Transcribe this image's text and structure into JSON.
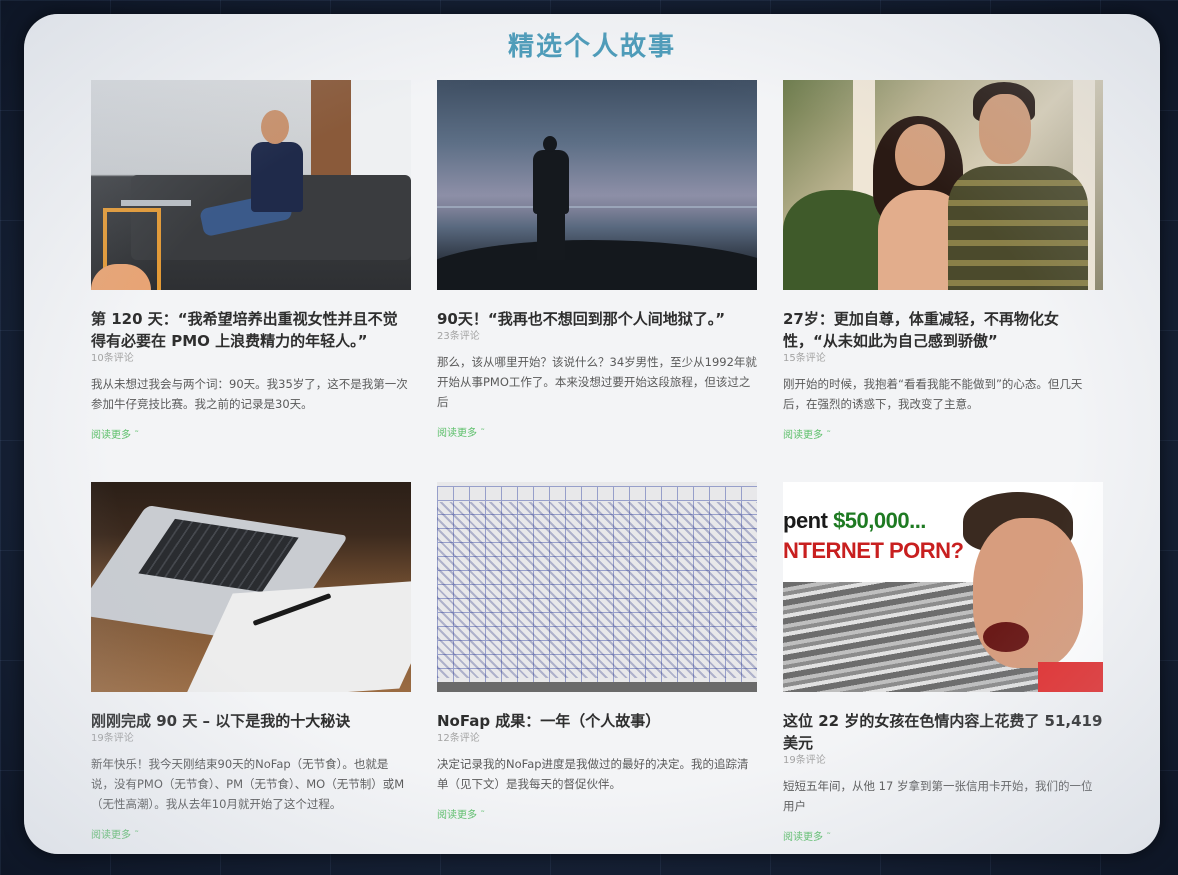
{
  "page": {
    "title": "精选个人故事"
  },
  "cards": [
    {
      "title": "第 120 天：“我希望培养出重视女性并且不觉得有必要在 PMO 上浪费精力的年轻人。”",
      "comments": "10条评论",
      "excerpt": "我从未想过我会与两个词：90天。我35岁了，这不是我第一次参加牛仔竞技比赛。我之前的记录是30天。",
      "more": "阅读更多 ˜",
      "image_icon": "man-on-sofa-laptop-photo"
    },
    {
      "title": "90天！“我再也不想回到那个人间地狱了。”",
      "comments": "23条评论",
      "excerpt": "那么，该从哪里开始？该说什么？34岁男性，至少从1992年就开始从事PMO工作了。本来没想过要开始这段旅程，但该过之后",
      "more": "阅读更多 ˜",
      "image_icon": "man-silhouette-lake-photo"
    },
    {
      "title": "27岁：更加自尊，体重减轻，不再物化女性，“从未如此为自己感到骄傲”",
      "comments": "15条评论",
      "excerpt": "刚开始的时候，我抱着“看看我能不能做到”的心态。但几天后，在强烈的诱惑下，我改变了主意。",
      "more": "阅读更多 ˜",
      "image_icon": "smiling-couple-photo"
    },
    {
      "title": "刚刚完成 90 天 – 以下是我的十大秘诀",
      "comments": "19条评论",
      "excerpt": "新年快乐！我今天刚结束90天的NoFap（无节食）。也就是说，没有PMO（无节食）、PM（无节食）、MO（无节制）或M（无性高潮）。我从去年10月就开始了这个过程。",
      "more": "阅读更多 ˜",
      "image_icon": "laptop-notebook-pen-photo"
    },
    {
      "title": "NoFap 成果：一年（个人故事）",
      "comments": "12条评论",
      "excerpt": "决定记录我的NoFap进度是我做过的最好的决定。我的追踪清单（见下文）是我每天的督促伙伴。",
      "more": "阅读更多 ˜",
      "image_icon": "handwritten-tracking-chart-photo"
    },
    {
      "title": "这位 22 岁的女孩在色情内容上花费了 51,419 美元",
      "comments": "19条评论",
      "excerpt": "短短五年间，从他 17 岁拿到第一张信用卡开始，我们的一位用户",
      "more": "阅读更多 ˜",
      "image_icon": "money-pile-screaming-man-photo",
      "image_text_line1_prefix": "pent ",
      "image_text_line1_amount": "$50,000...",
      "image_text_line2": "NTERNET PORN?"
    }
  ]
}
